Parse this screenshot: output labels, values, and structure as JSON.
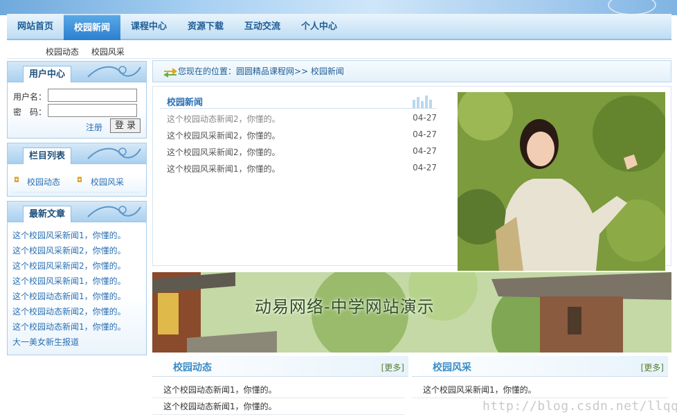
{
  "nav": {
    "items": [
      {
        "label": "网站首页"
      },
      {
        "label": "校园新闻"
      },
      {
        "label": "课程中心"
      },
      {
        "label": "资源下载"
      },
      {
        "label": "互动交流"
      },
      {
        "label": "个人中心"
      }
    ],
    "active": "校园新闻"
  },
  "subnav": [
    "校园动态",
    "校园风采"
  ],
  "user_center": {
    "title": "用户中心",
    "username_label": "用户名：",
    "password_label": "密　码：",
    "register": "注册",
    "login": "登 录"
  },
  "category": {
    "title": "栏目列表",
    "items": [
      "校园动态",
      "校园风采"
    ]
  },
  "latest": {
    "title": "最新文章",
    "items": [
      "这个校园风采新闻1，你懂的。",
      "这个校园风采新闻2，你懂的。",
      "这个校园风采新闻2，你懂的。",
      "这个校园风采新闻1，你懂的。",
      "这个校园动态新闻1，你懂的。",
      "这个校园动态新闻2，你懂的。",
      "这个校园动态新闻1，你懂的。",
      "大一美女新生报道"
    ]
  },
  "location": {
    "prefix": "您现在的位置：",
    "path": "圆圆精品课程网>> 校园新闻"
  },
  "news": {
    "title": "校园新闻",
    "rows": [
      {
        "title": "这个校园动态新闻2，你懂的。",
        "date": "04-27"
      },
      {
        "title": "这个校园风采新闻2，你懂的。",
        "date": "04-27"
      },
      {
        "title": "这个校园风采新闻2，你懂的。",
        "date": "04-27"
      },
      {
        "title": "这个校园风采新闻1，你懂的。",
        "date": "04-27"
      }
    ]
  },
  "banner": {
    "label": "动易网络-中学网站演示"
  },
  "sections": [
    {
      "title": "校园动态",
      "more": "[更多]",
      "rows": [
        "这个校园动态新闻1，你懂的。",
        "这个校园动态新闻1，你懂的。"
      ]
    },
    {
      "title": "校园风采",
      "more": "[更多]",
      "rows": [
        "这个校园风采新闻1，你懂的。"
      ]
    }
  ],
  "watermark": "http://blog.csdn.net/llqqxf",
  "colors": {
    "nav_active": "#2b7fcf",
    "link": "#2a6fb3",
    "border": "#a9cbe7"
  }
}
